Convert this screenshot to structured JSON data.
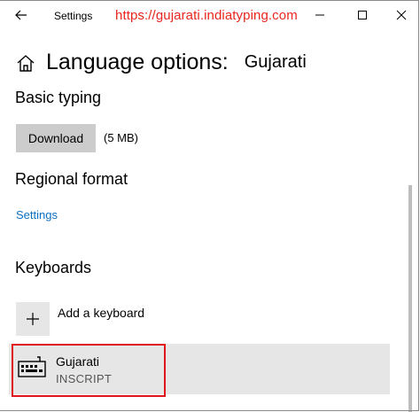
{
  "titlebar": {
    "app_title": "Settings",
    "url_overlay": "https://gujarati.indiatyping.com",
    "url_color": "#e8261c"
  },
  "header": {
    "title": "Language options:",
    "language": "Gujarati"
  },
  "basic_typing": {
    "title": "Basic typing",
    "download_label": "Download",
    "size": "(5 MB)"
  },
  "regional_format": {
    "title": "Regional format",
    "settings_link": "Settings",
    "link_color": "#0a6fc2"
  },
  "keyboards": {
    "title": "Keyboards",
    "add_label": "Add a keyboard",
    "items": [
      {
        "name": "Gujarati",
        "layout": "INSCRIPT",
        "icon": "keyboard-icon"
      }
    ],
    "highlight_color": "#e0161d"
  }
}
